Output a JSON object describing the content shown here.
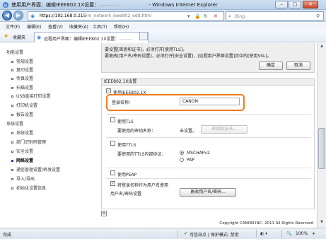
{
  "window": {
    "title": "使用用户界面：编辑IEEE802.1X设置：",
    "title_masked": "————",
    "title_suffix": "- Windows Internet Explorer",
    "minimize": "–",
    "maximize": "▢",
    "close": "✕"
  },
  "nav": {
    "back": "◀",
    "forward": "▶",
    "url_host": "https://192.168.0.215",
    "url_path": "/rn_network_ieee802_edit.html",
    "search_placeholder": "Bing"
  },
  "menu": [
    "文件(F)",
    "编辑(E)",
    "查看(V)",
    "收藏夹(A)",
    "工具(T)",
    "帮助(H)"
  ],
  "favorites": {
    "label": "收藏夹",
    "tab_title": "远程用户界面：编辑IEEE802.1X设置：",
    "tab_masked": "———"
  },
  "sidebar": {
    "groups": [
      {
        "heading": "功能设置",
        "items": [
          "常规设置",
          "复印设置",
          "传真设置",
          "扫描设置",
          "USB直接打印设置",
          "打印机设置",
          "报告设置"
        ]
      },
      {
        "heading": "系统设置",
        "items": [
          "系统设置",
          "部门识别码管理",
          "安全设置",
          "网络设置",
          "通信管理设置/转发设置",
          "导入/导出",
          "初始化设置信息"
        ]
      }
    ],
    "active_item": "网络设置"
  },
  "notes": {
    "line1": "要设置[密钥和证书]，必须打开[使用TLS]。",
    "line2": "要更改[用户名/密码设置]，必须打开[安全设置]，[远程用户界面设置]页中的[使用SSL]。",
    "ok_button": "确定",
    "cancel_button": "取消"
  },
  "ieee": {
    "section_title": "IEEE802.1X设置",
    "use_ieee": "使用IEEE802.1X",
    "login_label": "登录名称：",
    "login_value": "CANON",
    "use_tls": "使用TLS",
    "tls_key_label": "要使用的密钥名称：",
    "tls_key_value": "未设置。",
    "tls_key_button": "密钥和证书...",
    "use_ttls": "使用TTLS",
    "ttls_proto_label": "要使用的TTLS内部协议：",
    "ttls_option1": "MSCHAPv2",
    "ttls_option2": "PAP",
    "use_peap": "使用PEAP",
    "use_login_as_user": "将登录名称作为用户名使用",
    "userpass_label": "用户名/密码设置",
    "userpass_button": "更改用户名/密码..."
  },
  "copyright": "Copyright CANON INC. 2011 All Rights Reserved",
  "status": {
    "left": "完成",
    "zone": "可信站点 | 保护模式: 禁用",
    "zoom": "100%"
  },
  "colors": {
    "highlight": "#f07c1e",
    "chrome": "#dbe7f4"
  }
}
